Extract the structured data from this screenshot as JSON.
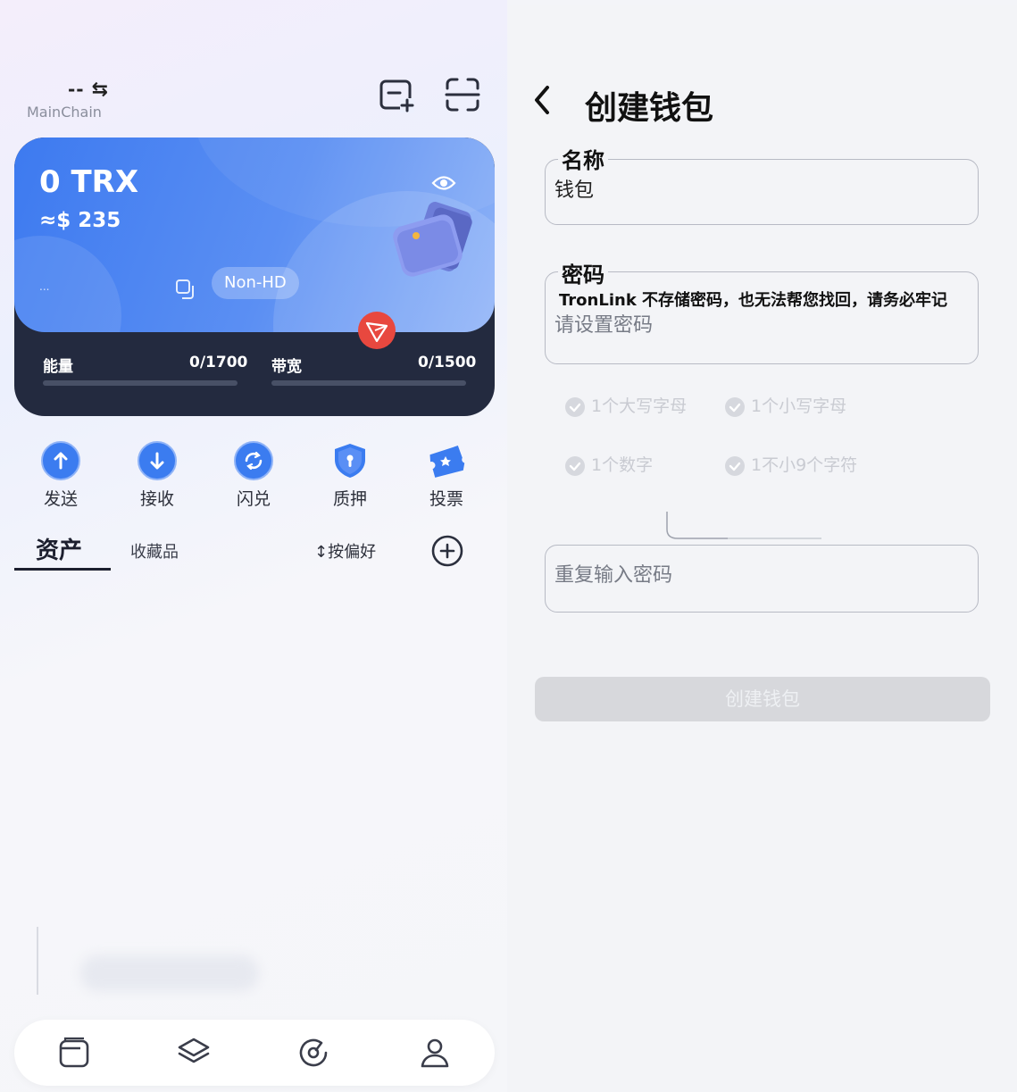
{
  "wallet": {
    "network_symbol": "--",
    "network_name": "MainChain",
    "balance": "0 TRX",
    "usd_value": "≈$ 235",
    "address_masked": "...",
    "wallet_type": "Non-HD",
    "energy_label": "能量",
    "energy_value": "0/1700",
    "bandwidth_label": "带宽",
    "bandwidth_value": "0/1500"
  },
  "actions": [
    {
      "label": "发送",
      "icon": "send-icon",
      "color": "#3b7cf0"
    },
    {
      "label": "接收",
      "icon": "receive-icon",
      "color": "#3b7cf0"
    },
    {
      "label": "闪兑",
      "icon": "swap-icon",
      "color": "#3b7cf0"
    },
    {
      "label": "质押",
      "icon": "stake-shield-icon",
      "color": "#3b7cf0"
    },
    {
      "label": "投票",
      "icon": "vote-ticket-icon",
      "color": "#3b7cf0"
    }
  ],
  "tabs": {
    "assets": "资产",
    "collectibles": "收藏品",
    "sort_label": "按偏好"
  },
  "bottom_nav": [
    "wallet-icon",
    "layers-icon",
    "discover-icon",
    "profile-icon"
  ],
  "create_wallet": {
    "title": "创建钱包",
    "name_label": "名称",
    "name_value": "钱包",
    "password_label": "密码",
    "password_note": "TronLink 不存储密码，也无法帮您找回，请务必牢记",
    "password_placeholder": "请设置密码",
    "rules": [
      "1个大写字母",
      "1个小写字母",
      "1个数字",
      "1不小9个字符"
    ],
    "confirm_placeholder": "重复输入密码",
    "submit_label": "创建钱包"
  },
  "colors": {
    "accent": "#3d7af0",
    "card_dark": "#232a3f",
    "tron_red": "#e8483f",
    "disabled": "#d7d8dc"
  }
}
